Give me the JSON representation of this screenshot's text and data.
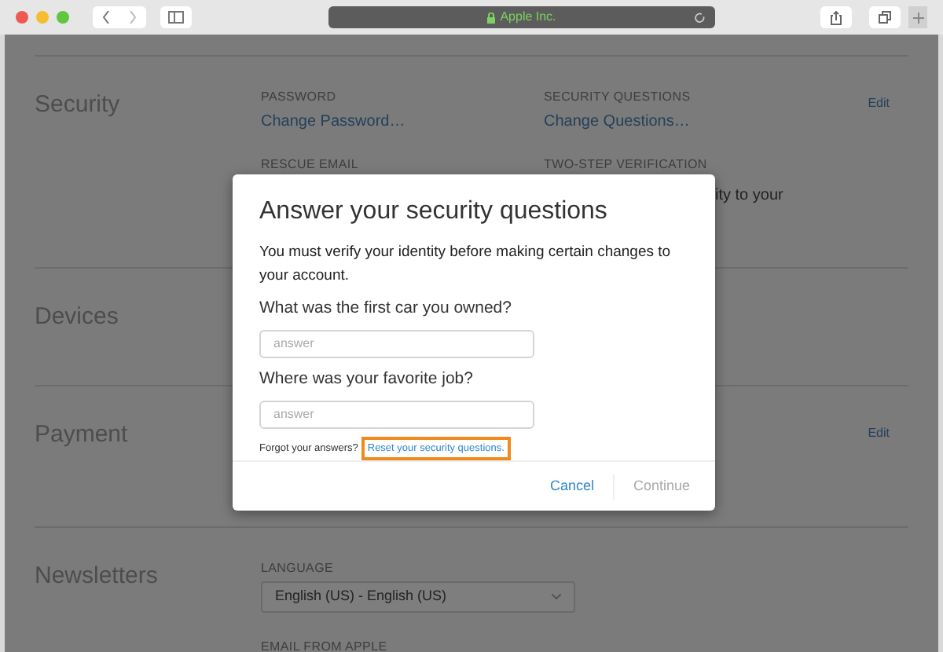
{
  "browser": {
    "address": "Apple Inc."
  },
  "sections": [
    {
      "title": "Security",
      "edit": "Edit",
      "fields": [
        {
          "label": "PASSWORD",
          "link": "Change Password…"
        },
        {
          "label": "SECURITY QUESTIONS",
          "link": "Change Questions…"
        },
        {
          "label": "RESCUE EMAIL"
        },
        {
          "label": "TWO-STEP VERIFICATION",
          "text": "ity to your"
        }
      ]
    },
    {
      "title": "Devices"
    },
    {
      "title": "Payment",
      "edit": "Edit"
    },
    {
      "title": "Newsletters",
      "fields": [
        {
          "label": "LANGUAGE",
          "select": "English (US) - English (US)"
        },
        {
          "label": "EMAIL FROM APPLE"
        }
      ]
    }
  ],
  "dialog": {
    "title": "Answer your security questions",
    "message": "You must verify your identity before making certain changes to your account.",
    "questions": [
      {
        "label": "What was the first car you owned?",
        "placeholder": "answer"
      },
      {
        "label": "Where was your favorite job?",
        "placeholder": "answer"
      }
    ],
    "forgot": "Forgot your answers?",
    "reset_link": {
      "label": "Reset your security questions.",
      "highlighted": true
    },
    "buttons": [
      {
        "label": "Cancel",
        "disabled": false
      },
      {
        "label": "Continue",
        "disabled": true
      }
    ]
  }
}
